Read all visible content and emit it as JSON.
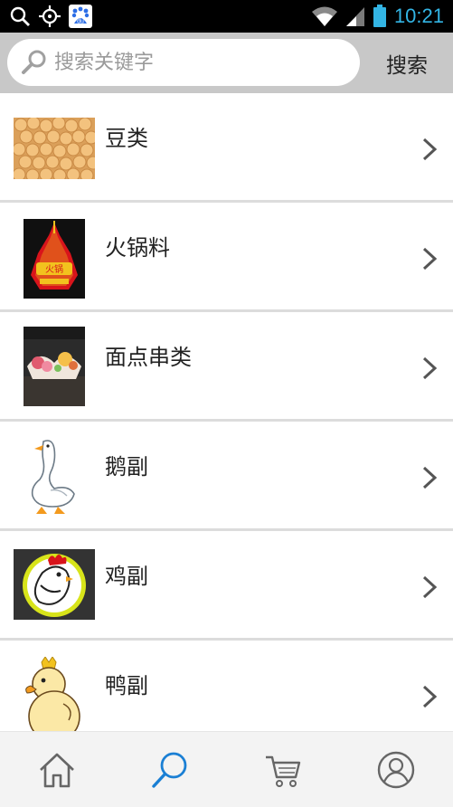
{
  "status_bar": {
    "time": "10:21",
    "baidu_badge": "du"
  },
  "search": {
    "placeholder": "搜索关键字",
    "button_label": "搜索"
  },
  "categories": [
    {
      "label": "豆类"
    },
    {
      "label": "火锅料",
      "thumb_text": "火锅"
    },
    {
      "label": "面点串类"
    },
    {
      "label": "鹅副"
    },
    {
      "label": "鸡副"
    },
    {
      "label": "鸭副"
    }
  ],
  "bottom_nav": {
    "items": [
      "home-icon",
      "search-icon",
      "cart-icon",
      "user-icon"
    ],
    "active": "search-icon",
    "active_color": "#1a7fd4",
    "inactive_color": "#666666"
  }
}
